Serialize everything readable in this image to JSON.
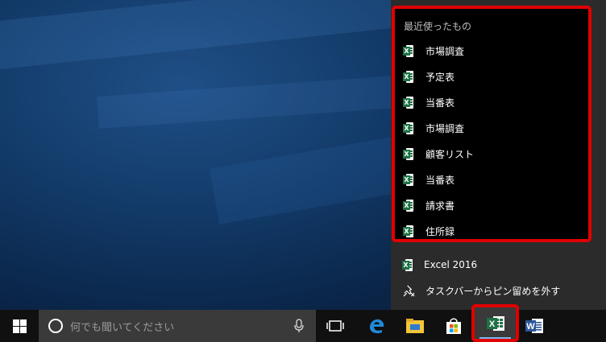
{
  "jumplist": {
    "recent_title": "最近使ったもの",
    "recent_items": [
      {
        "label": "市場調査"
      },
      {
        "label": "予定表"
      },
      {
        "label": "当番表"
      },
      {
        "label": "市場調査"
      },
      {
        "label": "顧客リスト"
      },
      {
        "label": "当番表"
      },
      {
        "label": "請求書"
      },
      {
        "label": "住所録"
      }
    ],
    "app_name": "Excel 2016",
    "unpin_label": "タスクバーからピン留めを外す"
  },
  "taskbar": {
    "search_placeholder": "何でも聞いてください",
    "excel_badge": "X",
    "word_badge": "W"
  },
  "colors": {
    "highlight": "#e00000",
    "excel_green": "#1e7145",
    "word_blue": "#2b579a",
    "edge_blue": "#1f8ad8",
    "explorer_yellow": "#f3c53a"
  }
}
